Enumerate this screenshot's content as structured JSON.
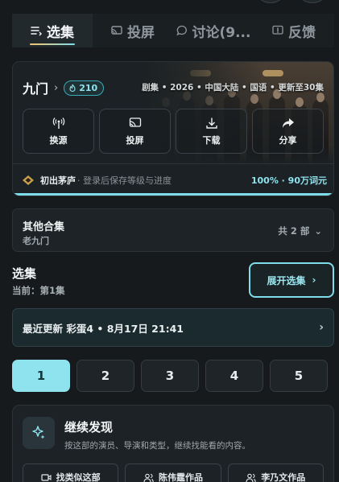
{
  "tabs": [
    {
      "label": "选集",
      "icon": "list-icon",
      "active": true
    },
    {
      "label": "投屏",
      "icon": "cast-icon",
      "active": false
    },
    {
      "label": "讨论(9...",
      "icon": "comment-icon",
      "active": false
    },
    {
      "label": "反馈",
      "icon": "feedback-icon",
      "active": false
    }
  ],
  "show": {
    "title": "九门",
    "badge": "210",
    "meta": "剧集 • 2026 • 中国大陆 • 国语 • 更新至30集"
  },
  "actions": [
    {
      "label": "换源",
      "icon": "signal-icon"
    },
    {
      "label": "投屏",
      "icon": "cast-icon"
    },
    {
      "label": "下载",
      "icon": "download-icon"
    },
    {
      "label": "分享",
      "icon": "share-icon"
    }
  ],
  "progress": {
    "rank": "初出茅庐",
    "hint": "· 登录后保存等级与进度",
    "value": "100% · 90万词元",
    "fraction": 1.0
  },
  "collection": {
    "heading": "其他合集",
    "subtitle": "老九门",
    "count": "共 2 部"
  },
  "episodes": {
    "title": "选集",
    "current": "当前：第1集",
    "expand_label": "展开选集",
    "latest": "最近更新 彩蛋4 • 8月17日 21:41",
    "buttons": [
      "1",
      "2",
      "3",
      "4",
      "5"
    ]
  },
  "discover": {
    "title": "继续发现",
    "description": "按这部的演员、导演和类型，继续找能看的内容。",
    "chips": [
      {
        "label": "找类似这部",
        "icon": "video-icon"
      },
      {
        "label": "陈伟霆作品",
        "icon": "people-icon"
      },
      {
        "label": "李乃文作品",
        "icon": "people-icon"
      }
    ]
  },
  "colors": {
    "accent": "#8fe3ee",
    "background": "#161a1d"
  }
}
